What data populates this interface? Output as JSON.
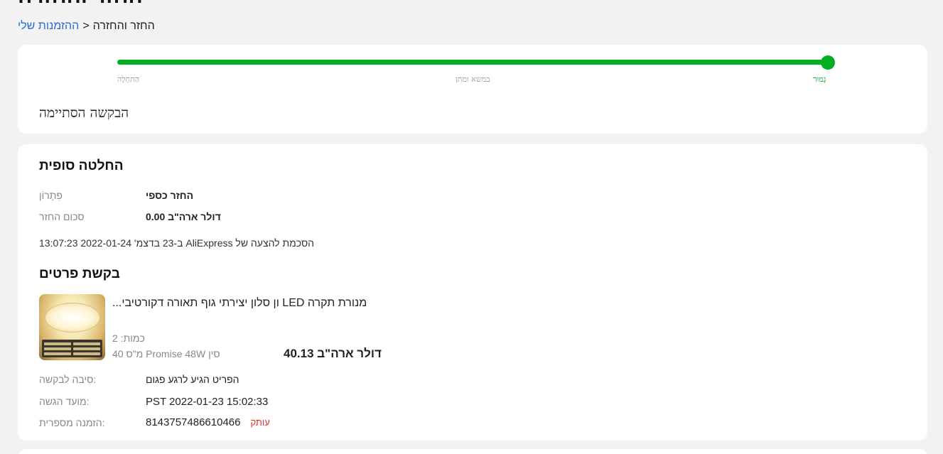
{
  "header": {
    "title": "החזר והחזרה"
  },
  "breadcrumb": {
    "link": "ההזמנות שלי",
    "separator": ">",
    "current": "החזר והחזרה"
  },
  "progress": {
    "value": 1.0,
    "steps": {
      "start": "הַתחָלָה",
      "middle": "במשא ומתן",
      "done": "גָמוּר"
    },
    "status_title": "הבקשה הסתיימה"
  },
  "decision": {
    "title": "החלטה סופית",
    "solution_label": "פִּתָרוֹן",
    "solution_value": "החזר כספי",
    "refund_label": "סכום החזר",
    "refund_value": "0.00 דולר ארה\"ב",
    "agree_text": "ב-23 בדצמ' 2022-01-24 13:07:23 AliExpress הסכמת להצעה של"
  },
  "request": {
    "title": "בקשת פרטים",
    "product": {
      "title": "מנורת תקרה LED יצירתי גוף תאורה דקורטיבי סלון...",
      "title_display": "...ון סלון יצירתי גוף תאורה דקורטיבי LED מנורת תקרה",
      "quantity": "כמות: 2",
      "sku": "40 מ\"ס Promise 48W סין",
      "price": "40.13 דולר ארה\"ב",
      "image": "ceiling-lamp-thumbnail"
    },
    "reason_label": "סיבה לבקשה:",
    "reason_value": "הפריט הגיע לרגע פגום",
    "submitted_label": "מועד הגשה:",
    "submitted_value": "PST 2022-01-23 15:02:33",
    "order_label": "הזמנה מספרית:",
    "order_value": "8143757486610466",
    "copy_label": "עותק"
  },
  "colors": {
    "accent_green": "#00b021",
    "link_blue": "#2a6ad6",
    "copy_red": "#e0322b"
  }
}
